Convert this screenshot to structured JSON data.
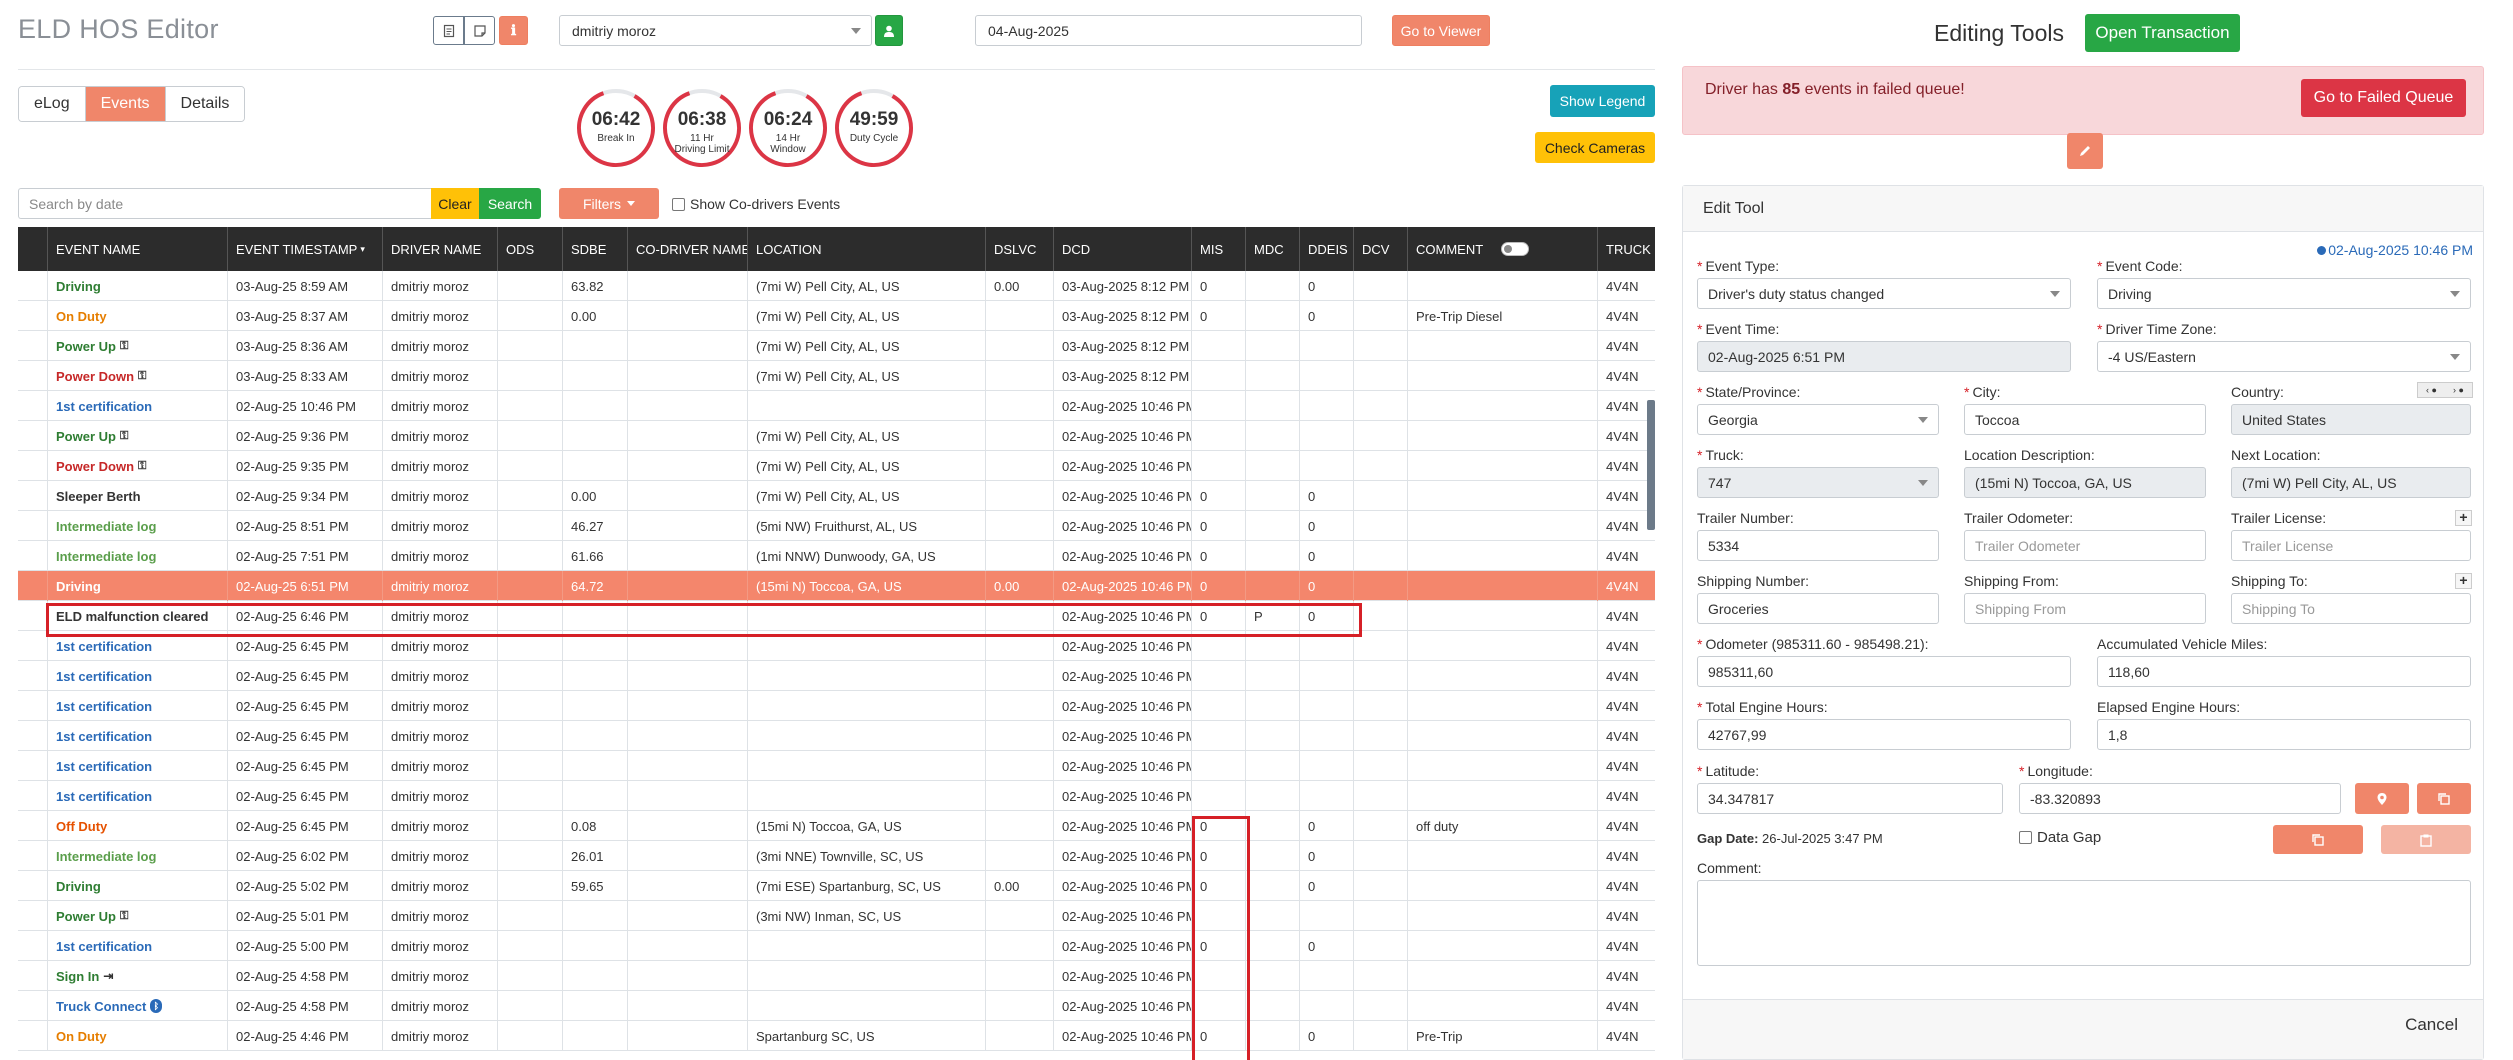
{
  "app": {
    "title": "ELD HOS Editor"
  },
  "topbar": {
    "driver_select": "dmitriy moroz",
    "date": "04-Aug-2025",
    "go_viewer": "Go to Viewer"
  },
  "tabs": [
    "eLog",
    "Events",
    "Details"
  ],
  "gauges": [
    {
      "value": "06:42",
      "label1": "Break In",
      "label2": ""
    },
    {
      "value": "06:38",
      "label1": "11 Hr",
      "label2": "Driving Limit"
    },
    {
      "value": "06:24",
      "label1": "14 Hr",
      "label2": "Window"
    },
    {
      "value": "49:59",
      "label1": "Duty Cycle",
      "label2": ""
    }
  ],
  "actions": {
    "show_legend": "Show Legend",
    "check_cameras": "Check Cameras",
    "search_placeholder": "Search by date",
    "clear": "Clear",
    "search": "Search",
    "filters": "Filters",
    "show_codrivers": "Show Co-drivers Events"
  },
  "table": {
    "headers": {
      "event_name": "EVENT NAME",
      "timestamp": "EVENT TIMESTAMP",
      "driver": "DRIVER NAME",
      "ods": "ODS",
      "sdbe": "SDBE",
      "codriver": "CO-DRIVER NAME",
      "location": "LOCATION",
      "dslvc": "DSLVC",
      "dcd": "DCD",
      "mis": "MIS",
      "mdc": "MDC",
      "ddeis": "DDEIS",
      "dcv": "DCV",
      "comment": "COMMENT",
      "truck": "TRUCK"
    },
    "rows": [
      {
        "name": "Driving",
        "color": "#2e7d32",
        "icon": "",
        "ts": "03-Aug-25 8:59 AM",
        "driver": "dmitriy moroz",
        "sdbe": "63.82",
        "loc": "(7mi W) Pell City, AL, US",
        "dslvc": "0.00",
        "dcd": "03-Aug-2025 8:12 PM",
        "mis": "0",
        "mdc": "",
        "ddeis": "0",
        "comment": "",
        "truck": "4V4N"
      },
      {
        "name": "On Duty",
        "color": "#e67e00",
        "icon": "",
        "ts": "03-Aug-25 8:37 AM",
        "driver": "dmitriy moroz",
        "sdbe": "0.00",
        "loc": "(7mi W) Pell City, AL, US",
        "dslvc": "",
        "dcd": "03-Aug-2025 8:12 PM",
        "mis": "0",
        "mdc": "",
        "ddeis": "0",
        "comment": "Pre-Trip Diesel",
        "truck": "4V4N"
      },
      {
        "name": "Power Up",
        "color": "#2e7d32",
        "icon": "key",
        "ts": "03-Aug-25 8:36 AM",
        "driver": "dmitriy moroz",
        "sdbe": "",
        "loc": "(7mi W) Pell City, AL, US",
        "dslvc": "",
        "dcd": "03-Aug-2025 8:12 PM",
        "mis": "",
        "mdc": "",
        "ddeis": "",
        "comment": "",
        "truck": "4V4N"
      },
      {
        "name": "Power Down",
        "color": "#c62828",
        "icon": "key",
        "ts": "03-Aug-25 8:33 AM",
        "driver": "dmitriy moroz",
        "sdbe": "",
        "loc": "(7mi W) Pell City, AL, US",
        "dslvc": "",
        "dcd": "03-Aug-2025 8:12 PM",
        "mis": "",
        "mdc": "",
        "ddeis": "",
        "comment": "",
        "truck": "4V4N"
      },
      {
        "name": "1st certification",
        "color": "#2a6ab8",
        "icon": "",
        "ts": "02-Aug-25 10:46 PM",
        "driver": "dmitriy moroz",
        "sdbe": "",
        "loc": "",
        "dslvc": "",
        "dcd": "02-Aug-2025 10:46 PM",
        "mis": "",
        "mdc": "",
        "ddeis": "",
        "comment": "",
        "truck": "4V4N"
      },
      {
        "name": "Power Up",
        "color": "#2e7d32",
        "icon": "key",
        "ts": "02-Aug-25 9:36 PM",
        "driver": "dmitriy moroz",
        "sdbe": "",
        "loc": "(7mi W) Pell City, AL, US",
        "dslvc": "",
        "dcd": "02-Aug-2025 10:46 PM",
        "mis": "",
        "mdc": "",
        "ddeis": "",
        "comment": "",
        "truck": "4V4N"
      },
      {
        "name": "Power Down",
        "color": "#c62828",
        "icon": "key",
        "ts": "02-Aug-25 9:35 PM",
        "driver": "dmitriy moroz",
        "sdbe": "",
        "loc": "(7mi W) Pell City, AL, US",
        "dslvc": "",
        "dcd": "02-Aug-2025 10:46 PM",
        "mis": "",
        "mdc": "",
        "ddeis": "",
        "comment": "",
        "truck": "4V4N"
      },
      {
        "name": "Sleeper Berth",
        "color": "#333333",
        "icon": "",
        "ts": "02-Aug-25 9:34 PM",
        "driver": "dmitriy moroz",
        "sdbe": "0.00",
        "loc": "(7mi W) Pell City, AL, US",
        "dslvc": "",
        "dcd": "02-Aug-2025 10:46 PM",
        "mis": "0",
        "mdc": "",
        "ddeis": "0",
        "comment": "",
        "truck": "4V4N"
      },
      {
        "name": "Intermediate log",
        "color": "#5a9e4b",
        "icon": "",
        "ts": "02-Aug-25 8:51 PM",
        "driver": "dmitriy moroz",
        "sdbe": "46.27",
        "loc": "(5mi NW) Fruithurst, AL, US",
        "dslvc": "",
        "dcd": "02-Aug-2025 10:46 PM",
        "mis": "0",
        "mdc": "",
        "ddeis": "0",
        "comment": "",
        "truck": "4V4N"
      },
      {
        "name": "Intermediate log",
        "color": "#5a9e4b",
        "icon": "",
        "ts": "02-Aug-25 7:51 PM",
        "driver": "dmitriy moroz",
        "sdbe": "61.66",
        "loc": "(1mi NNW) Dunwoody, GA, US",
        "dslvc": "",
        "dcd": "02-Aug-2025 10:46 PM",
        "mis": "0",
        "mdc": "",
        "ddeis": "0",
        "comment": "",
        "truck": "4V4N"
      },
      {
        "name": "Driving",
        "color": "#ffffff",
        "icon": "",
        "ts": "02-Aug-25 6:51 PM",
        "driver": "dmitriy moroz",
        "sdbe": "64.72",
        "loc": "(15mi N) Toccoa, GA, US",
        "dslvc": "0.00",
        "dcd": "02-Aug-2025 10:46 PM",
        "mis": "0",
        "mdc": "",
        "ddeis": "0",
        "comment": "",
        "truck": "4V4N",
        "selected": true
      },
      {
        "name": "ELD malfunction cleared",
        "color": "#333333",
        "icon": "",
        "ts": "02-Aug-25 6:46 PM",
        "driver": "dmitriy moroz",
        "sdbe": "",
        "loc": "",
        "dslvc": "",
        "dcd": "02-Aug-2025 10:46 PM",
        "mis": "0",
        "mdc": "P",
        "ddeis": "0",
        "comment": "",
        "truck": "4V4N"
      },
      {
        "name": "1st certification",
        "color": "#2a6ab8",
        "icon": "",
        "ts": "02-Aug-25 6:45 PM",
        "driver": "dmitriy moroz",
        "sdbe": "",
        "loc": "",
        "dslvc": "",
        "dcd": "02-Aug-2025 10:46 PM",
        "mis": "",
        "mdc": "",
        "ddeis": "",
        "comment": "",
        "truck": "4V4N"
      },
      {
        "name": "1st certification",
        "color": "#2a6ab8",
        "icon": "",
        "ts": "02-Aug-25 6:45 PM",
        "driver": "dmitriy moroz",
        "sdbe": "",
        "loc": "",
        "dslvc": "",
        "dcd": "02-Aug-2025 10:46 PM",
        "mis": "",
        "mdc": "",
        "ddeis": "",
        "comment": "",
        "truck": "4V4N"
      },
      {
        "name": "1st certification",
        "color": "#2a6ab8",
        "icon": "",
        "ts": "02-Aug-25 6:45 PM",
        "driver": "dmitriy moroz",
        "sdbe": "",
        "loc": "",
        "dslvc": "",
        "dcd": "02-Aug-2025 10:46 PM",
        "mis": "",
        "mdc": "",
        "ddeis": "",
        "comment": "",
        "truck": "4V4N"
      },
      {
        "name": "1st certification",
        "color": "#2a6ab8",
        "icon": "",
        "ts": "02-Aug-25 6:45 PM",
        "driver": "dmitriy moroz",
        "sdbe": "",
        "loc": "",
        "dslvc": "",
        "dcd": "02-Aug-2025 10:46 PM",
        "mis": "",
        "mdc": "",
        "ddeis": "",
        "comment": "",
        "truck": "4V4N"
      },
      {
        "name": "1st certification",
        "color": "#2a6ab8",
        "icon": "",
        "ts": "02-Aug-25 6:45 PM",
        "driver": "dmitriy moroz",
        "sdbe": "",
        "loc": "",
        "dslvc": "",
        "dcd": "02-Aug-2025 10:46 PM",
        "mis": "",
        "mdc": "",
        "ddeis": "",
        "comment": "",
        "truck": "4V4N"
      },
      {
        "name": "1st certification",
        "color": "#2a6ab8",
        "icon": "",
        "ts": "02-Aug-25 6:45 PM",
        "driver": "dmitriy moroz",
        "sdbe": "",
        "loc": "",
        "dslvc": "",
        "dcd": "02-Aug-2025 10:46 PM",
        "mis": "",
        "mdc": "",
        "ddeis": "",
        "comment": "",
        "truck": "4V4N"
      },
      {
        "name": "Off Duty",
        "color": "#e65100",
        "icon": "",
        "ts": "02-Aug-25 6:45 PM",
        "driver": "dmitriy moroz",
        "sdbe": "0.08",
        "loc": "(15mi N) Toccoa, GA, US",
        "dslvc": "",
        "dcd": "02-Aug-2025 10:46 PM",
        "mis": "0",
        "mdc": "",
        "ddeis": "0",
        "comment": "off duty",
        "truck": "4V4N"
      },
      {
        "name": "Intermediate log",
        "color": "#5a9e4b",
        "icon": "",
        "ts": "02-Aug-25 6:02 PM",
        "driver": "dmitriy moroz",
        "sdbe": "26.01",
        "loc": "(3mi NNE) Townville, SC, US",
        "dslvc": "",
        "dcd": "02-Aug-2025 10:46 PM",
        "mis": "0",
        "mdc": "",
        "ddeis": "0",
        "comment": "",
        "truck": "4V4N"
      },
      {
        "name": "Driving",
        "color": "#2e7d32",
        "icon": "",
        "ts": "02-Aug-25 5:02 PM",
        "driver": "dmitriy moroz",
        "sdbe": "59.65",
        "loc": "(7mi ESE) Spartanburg, SC, US",
        "dslvc": "0.00",
        "dcd": "02-Aug-2025 10:46 PM",
        "mis": "0",
        "mdc": "",
        "ddeis": "0",
        "comment": "",
        "truck": "4V4N"
      },
      {
        "name": "Power Up",
        "color": "#2e7d32",
        "icon": "key",
        "ts": "02-Aug-25 5:01 PM",
        "driver": "dmitriy moroz",
        "sdbe": "",
        "loc": "(3mi NW) Inman, SC, US",
        "dslvc": "",
        "dcd": "02-Aug-2025 10:46 PM",
        "mis": "",
        "mdc": "",
        "ddeis": "",
        "comment": "",
        "truck": "4V4N"
      },
      {
        "name": "1st certification",
        "color": "#2a6ab8",
        "icon": "",
        "ts": "02-Aug-25 5:00 PM",
        "driver": "dmitriy moroz",
        "sdbe": "",
        "loc": "",
        "dslvc": "",
        "dcd": "02-Aug-2025 10:46 PM",
        "mis": "0",
        "mdc": "",
        "ddeis": "0",
        "comment": "",
        "truck": "4V4N"
      },
      {
        "name": "Sign In",
        "color": "#2e7d32",
        "icon": "signin",
        "ts": "02-Aug-25 4:58 PM",
        "driver": "dmitriy moroz",
        "sdbe": "",
        "loc": "",
        "dslvc": "",
        "dcd": "02-Aug-2025 10:46 PM",
        "mis": "",
        "mdc": "",
        "ddeis": "",
        "comment": "",
        "truck": "4V4N"
      },
      {
        "name": "Truck Connect",
        "color": "#2a6ab8",
        "icon": "bluetooth",
        "ts": "02-Aug-25 4:58 PM",
        "driver": "dmitriy moroz",
        "sdbe": "",
        "loc": "",
        "dslvc": "",
        "dcd": "02-Aug-2025 10:46 PM",
        "mis": "",
        "mdc": "",
        "ddeis": "",
        "comment": "",
        "truck": "4V4N"
      },
      {
        "name": "On Duty",
        "color": "#e67e00",
        "icon": "",
        "ts": "02-Aug-25 4:46 PM",
        "driver": "dmitriy moroz",
        "sdbe": "",
        "loc": "Spartanburg SC, US",
        "dslvc": "",
        "dcd": "02-Aug-2025 10:46 PM",
        "mis": "0",
        "mdc": "",
        "ddeis": "0",
        "comment": "Pre-Trip",
        "truck": "4V4N"
      }
    ]
  },
  "editor": {
    "title": "Editing Tools",
    "open_transaction": "Open Transaction",
    "alert_prefix": "Driver has ",
    "alert_count": "85",
    "alert_suffix": " events in failed queue!",
    "go_failed": "Go to Failed Queue",
    "card_title": "Edit Tool",
    "timestamp": "02-Aug-2025 10:46 PM",
    "labels": {
      "event_type": "Event Type:",
      "event_code": "Event Code:",
      "event_time": "Event Time:",
      "driver_tz": "Driver Time Zone:",
      "state": "State/Province:",
      "city": "City:",
      "country": "Country:",
      "truck": "Truck:",
      "loc_desc": "Location Description:",
      "next_loc": "Next Location:",
      "trailer_number": "Trailer Number:",
      "trailer_odometer": "Trailer Odometer:",
      "trailer_license": "Trailer License:",
      "shipping_number": "Shipping Number:",
      "shipping_from": "Shipping From:",
      "shipping_to": "Shipping To:",
      "odometer": "Odometer (985311.60 - 985498.21):",
      "acc_miles": "Accumulated Vehicle Miles:",
      "engine_hours": "Total Engine Hours:",
      "elapsed_hours": "Elapsed Engine Hours:",
      "latitude": "Latitude:",
      "longitude": "Longitude:",
      "gap_date_label": "Gap Date:",
      "data_gap": "Data Gap",
      "comment": "Comment:"
    },
    "values": {
      "event_type": "Driver's duty status changed",
      "event_code": "Driving",
      "event_time": "02-Aug-2025 6:51 PM",
      "driver_tz": "-4 US/Eastern",
      "state": "Georgia",
      "city": "Toccoa",
      "country": "United States",
      "truck": "747",
      "loc_desc": "(15mi N) Toccoa, GA, US",
      "next_loc": "(7mi W) Pell City, AL, US",
      "trailer_number": "5334",
      "shipping_number": "Groceries",
      "odometer": "985311,60",
      "acc_miles": "118,60",
      "engine_hours": "42767,99",
      "elapsed_hours": "1,8",
      "latitude": "34.347817",
      "longitude": "-83.320893",
      "gap_date": "26-Jul-2025 3:47 PM"
    },
    "placeholders": {
      "trailer_odometer": "Trailer Odometer",
      "trailer_license": "Trailer License",
      "shipping_from": "Shipping From",
      "shipping_to": "Shipping To"
    },
    "cancel": "Cancel"
  }
}
